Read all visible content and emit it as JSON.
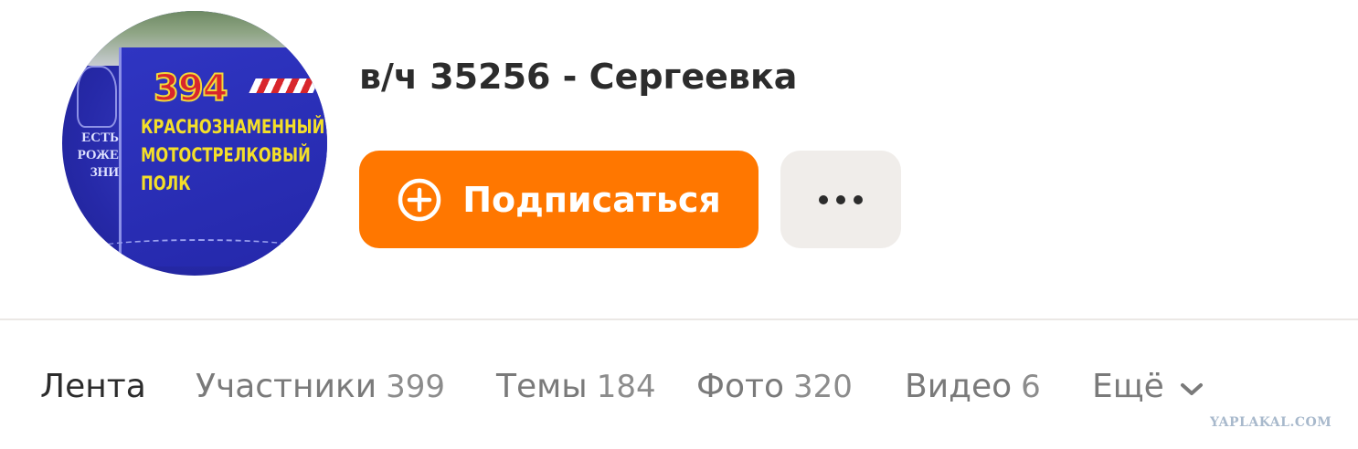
{
  "group": {
    "avatar": {
      "number": "394",
      "lines": [
        "КРАСНОЗНАМЕННЫЙ",
        "МОТОСТРЕЛКОВЫЙ",
        "ПОЛК"
      ],
      "side_lines": [
        "ЕСТЬ",
        "РОЖЕ",
        "ЗНИ"
      ]
    },
    "title": "в/ч 35256 - Сергеевка"
  },
  "actions": {
    "subscribe_label": "Подписаться",
    "subscribe_icon": "plus-circle-icon",
    "more_icon": "more-dots-icon",
    "accent_color": "#ff7700"
  },
  "tabs": [
    {
      "label": "Лента",
      "count": "",
      "active": true
    },
    {
      "label": "Участники",
      "count": "399",
      "active": false
    },
    {
      "label": "Темы",
      "count": "184",
      "active": false
    },
    {
      "label": "Фото",
      "count": "320",
      "active": false
    },
    {
      "label": "Видео",
      "count": "6",
      "active": false
    },
    {
      "label": "Ещё",
      "count": "",
      "active": false,
      "icon": "chevron-down-icon"
    }
  ],
  "watermark": "YAPLAKAL.COM"
}
